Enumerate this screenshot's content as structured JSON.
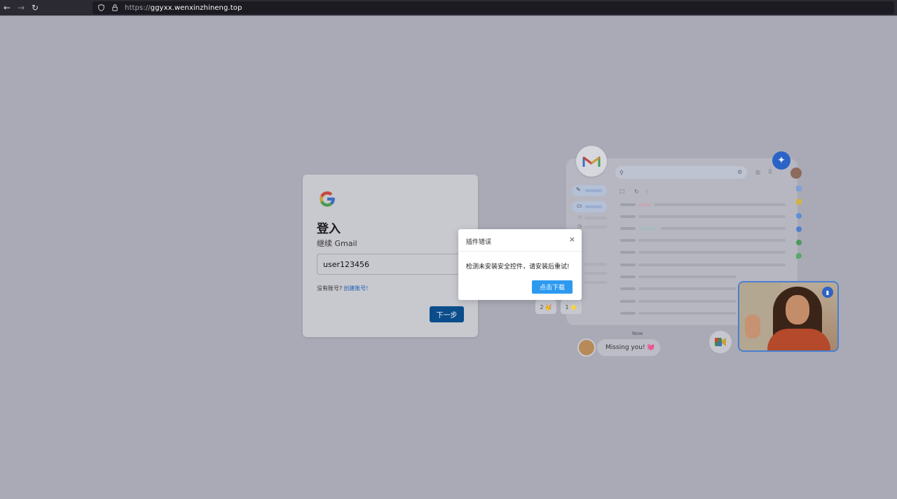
{
  "browser": {
    "back_icon": "←",
    "forward_icon": "→",
    "reload_icon": "↻",
    "url_scheme": "https://",
    "url_host": "ggyxx.wenxinzhineng.top"
  },
  "login": {
    "title": "登入",
    "subtitle": "继续 Gmail",
    "username_value": "user123456",
    "no_account": "没有账号?",
    "create_account_link": "创建账号!",
    "next_button": "下一步"
  },
  "dialog": {
    "title": "插件错误",
    "close_icon": "×",
    "message": "检测未安装安全控件，请安装后重试!",
    "download_button": "点击下载"
  },
  "illustration": {
    "chip_1_count": "2",
    "chip_1_emoji": "🥳",
    "chip_2_count": "1",
    "chip_2_emoji": "⭐",
    "chat_time": "Now",
    "chat_message": "Missing you! 💓"
  },
  "colors": {
    "page_background": "#a9aab6",
    "next_button": "#0b4d8a",
    "dialog_button": "#2d9af0",
    "link": "#1a5fb4"
  }
}
